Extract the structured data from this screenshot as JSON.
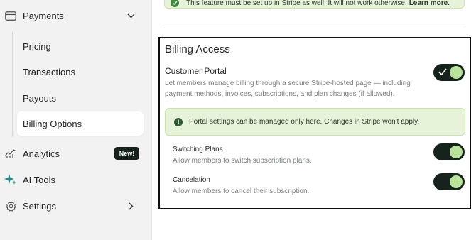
{
  "sidebar": {
    "payments": {
      "label": "Payments",
      "icon": "credit-card-icon"
    },
    "sub_items": [
      {
        "label": "Pricing"
      },
      {
        "label": "Transactions"
      },
      {
        "label": "Payouts"
      },
      {
        "label": "Billing Options",
        "active": true
      }
    ],
    "analytics": {
      "label": "Analytics",
      "badge": "New!",
      "icon": "chart-line-icon"
    },
    "ai_tools": {
      "label": "AI Tools",
      "icon": "sparkle-icon"
    },
    "settings": {
      "label": "Settings",
      "icon": "gear-icon"
    }
  },
  "top_alert": {
    "text": "This feature must be set up in Stripe as well. It will not work otherwise.",
    "link": "Learn more."
  },
  "billing_access": {
    "title": "Billing Access",
    "customer_portal": {
      "title": "Customer Portal",
      "description": "Let members manage billing through a secure Stripe-hosted page — including payment methods, invoices, subscriptions, and plan changes (if allowed).",
      "enabled": true
    },
    "info": "Portal settings can be managed only here. Changes in Stripe won't apply.",
    "switching_plans": {
      "title": "Switching Plans",
      "description": "Allow members to switch subscription plans.",
      "enabled": true
    },
    "cancelation": {
      "title": "Cancelation",
      "description": "Allow members to cancel their subscription.",
      "enabled": true
    }
  },
  "colors": {
    "toggle_track": "#16231d",
    "toggle_knob": "#b9e39a",
    "alert_bg": "#e7f3d9"
  }
}
